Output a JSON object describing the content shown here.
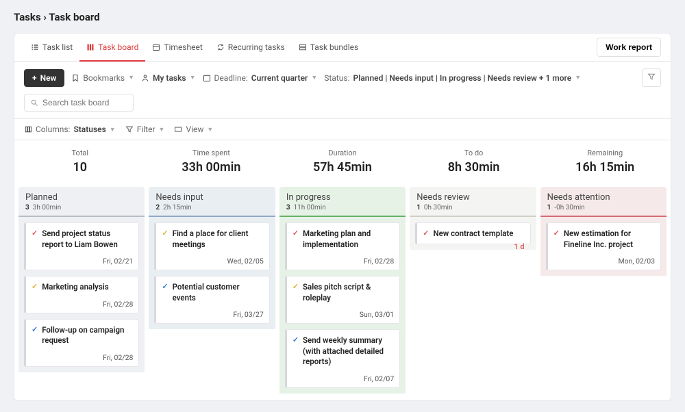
{
  "breadcrumb": {
    "parent": "Tasks",
    "sep": "›",
    "current": "Task board"
  },
  "tabs": [
    {
      "label": "Task list",
      "icon": "list-icon"
    },
    {
      "label": "Task board",
      "icon": "columns-icon"
    },
    {
      "label": "Timesheet",
      "icon": "calendar-icon"
    },
    {
      "label": "Recurring tasks",
      "icon": "refresh-icon"
    },
    {
      "label": "Task bundles",
      "icon": "bundle-icon"
    }
  ],
  "active_tab": 1,
  "work_report_label": "Work report",
  "toolbar": {
    "new_label": "New",
    "bookmarks_label": "Bookmarks",
    "mytasks_label": "My tasks",
    "deadline_label": "Deadline:",
    "deadline_value": "Current quarter",
    "status_label": "Status:",
    "status_value": "Planned | Needs input | In progress | Needs review + 1 more",
    "search_placeholder": "Search task board"
  },
  "toolbar2": {
    "columns_label": "Columns:",
    "columns_value": "Statuses",
    "filter_label": "Filter",
    "view_label": "View"
  },
  "summary": [
    {
      "label": "Total",
      "value": "10"
    },
    {
      "label": "Time spent",
      "value": "33h 00min"
    },
    {
      "label": "Duration",
      "value": "57h 45min"
    },
    {
      "label": "To do",
      "value": "8h 30min"
    },
    {
      "label": "Remaining",
      "value": "16h 15min"
    }
  ],
  "columns": [
    {
      "key": "planned",
      "title": "Planned",
      "count": "3",
      "time": "3h 00min",
      "cards": [
        {
          "priority": "red",
          "title": "Send project status report to Liam Bowen",
          "date": "Fri, 02/21"
        },
        {
          "priority": "yellow",
          "title": "Marketing analysis",
          "date": "Fri, 02/28"
        },
        {
          "priority": "blue",
          "title": "Follow-up on campaign request",
          "date": "Fri, 02/28"
        }
      ]
    },
    {
      "key": "needs-input",
      "title": "Needs input",
      "count": "2",
      "time": "2h 15min",
      "cards": [
        {
          "priority": "yellow",
          "title": "Find a place for client meetings",
          "date": "Wed, 02/05"
        },
        {
          "priority": "blue",
          "title": "Potential customer events",
          "date": "Fri, 03/27"
        }
      ]
    },
    {
      "key": "in-progress",
      "title": "In progress",
      "count": "3",
      "time": "11h 00min",
      "cards": [
        {
          "priority": "red",
          "title": "Marketing plan and implementation",
          "date": "Fri, 02/28"
        },
        {
          "priority": "yellow",
          "title": "Sales pitch script & roleplay",
          "date": "Sun, 03/01"
        },
        {
          "priority": "blue",
          "title": "Send weekly summary (with attached detailed reports)",
          "date": "Fri, 02/07"
        }
      ]
    },
    {
      "key": "needs-review",
      "title": "Needs review",
      "count": "1",
      "time": "0h 30min",
      "cards": [
        {
          "priority": "red",
          "title": "New contract template",
          "date": "",
          "due": "1 d"
        }
      ]
    },
    {
      "key": "needs-attention",
      "title": "Needs attention",
      "count": "1",
      "time": "-0h 30min",
      "cards": [
        {
          "priority": "red",
          "title": "New estimation for Fineline Inc. project",
          "date": "Mon, 02/03"
        }
      ]
    }
  ]
}
